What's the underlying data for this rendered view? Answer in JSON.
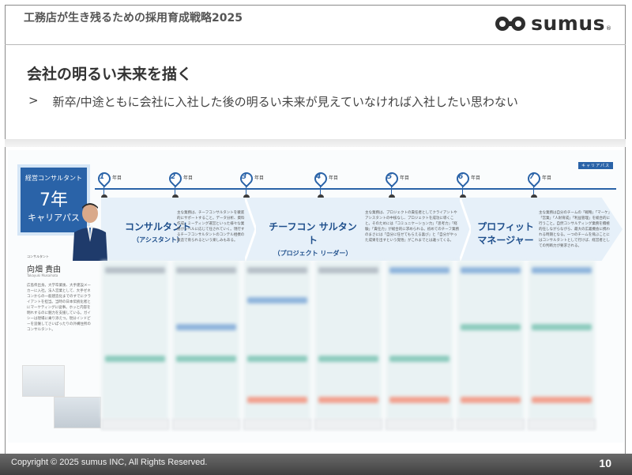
{
  "header": {
    "doc_title": "工務店が生き残るための採用育成戦略2025",
    "logo_text": "sumus",
    "logo_mark": "®"
  },
  "content": {
    "heading": "会社の明るい未来を描く",
    "bullet_marker": ">",
    "bullet_text": "新卒/中途ともに会社に入社した後の明るい未来が見えていなければ入社したい思わない"
  },
  "career_chart": {
    "box": {
      "label": "経営コンサルタント",
      "years": "7年",
      "title": "キャリアパス"
    },
    "tag": "キャリアパス",
    "year_suffix": "年目",
    "year_markers": [
      "1",
      "2",
      "3",
      "4",
      "5",
      "6",
      "7"
    ],
    "stages": [
      {
        "name": "コンサルタント",
        "sub": "（アシスタント）"
      },
      {
        "name": "チーフコン サルタント",
        "sub": "（プロジェクト リーダー）"
      },
      {
        "name": "プロフィット",
        "sub": "マネージャー"
      }
    ],
    "descriptions": [
      "主な業務は、チーフコンサルタントを徹底的にサポートすること。データ分析、資料作成、ミーティング運営といった様々な業務がレベルに応じて任されていく。現行するチーフコンサルタントのコンテル相撲の製造で育られるという楽しみもある。",
      "主な業務は、プロジェクトの責任者としてクライアントやアシスタントの中核なし、プロジェクトを成功に導くこと。そのためには「コミュニケーション力」「思考力」「経験」「責任力」が総合的に求められる。初めてのチーフ業務のまさには「自分に任せてもらえる喜び」と「自分がやった成果を出すという覚悟」がこれまでとは違ってくる。",
      "主な業務は自分のチームの「戦略」「マーケ」「営業」「人財育成」「利益管理」を総合的に行うこと。自然コンサルティング業務を積極的任しながらながら、最大の広義機会に携われる時期となる。一つのチームを飛ぶことにはコンサルタントとして行けば、経営者としての判断力が要求される。"
    ],
    "profile": {
      "label": "コンサルタント",
      "name": "向畑 貴由",
      "roman": "Takayuki Mukaihata",
      "text": "広島県出身。大学卒業後、大手建設メーカーに入社。法人営業として、大手ゼネコンからの一般建造化までのすでにクライアントを担当。当時の日本伝統化者とにマーケティングに従事。ホッと内容を明れするのに魅力を支援している。ガイシーは現場に乗り添えつ。現分インドピーを追懐してさいぽったりの外構住所のコンサルタント。"
    }
  },
  "footer": {
    "copyright": "Copyright © 2025 sumus INC, All Rights Reserved.",
    "page_number": "10"
  },
  "colors": {
    "accent": "#2a63a8",
    "band_blue": "#e6f0f9",
    "footer_gray": "#505050"
  }
}
